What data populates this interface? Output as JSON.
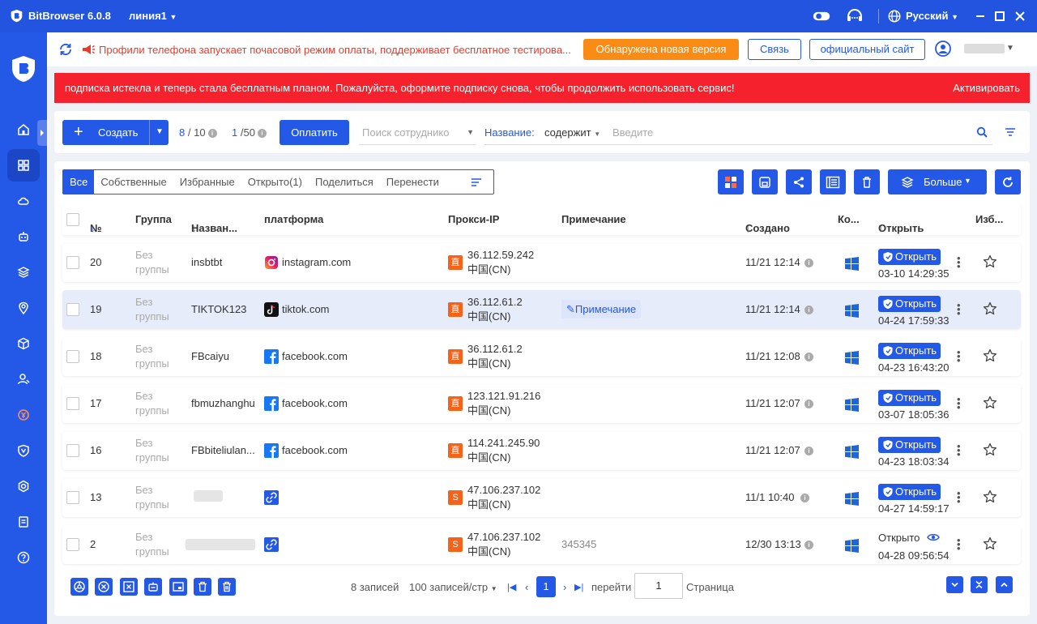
{
  "titlebar": {
    "app_name": "BitBrowser 6.0.8",
    "line": "линия1",
    "language": "Русский"
  },
  "notice": {
    "text": "Профили телефона запускает почасовой режим оплаты, поддерживает бесплатное тестирова...",
    "new_version": "Обнаружена новая версия",
    "contact": "Связь",
    "official_site": "официальный сайт"
  },
  "alert": {
    "text": "подписка истекла и теперь стала бесплатным планом. Пожалуйста, оформите подписку снова, чтобы продолжить использовать сервис!",
    "activate": "Активировать"
  },
  "toolbar": {
    "create": "Создать",
    "count_profiles": "8",
    "count_profiles_total": "/ 10",
    "count_staff": "1",
    "count_staff_total": "/50",
    "pay": "Оплатить",
    "employee_placeholder": "Поиск сотруднико",
    "filter_key": "Название:",
    "filter_op": "содержит",
    "filter_placeholder": "Введите"
  },
  "tabs": [
    "Все",
    "Собственные",
    "Избранные",
    "Открыто(1)",
    "Поделиться",
    "Перенести"
  ],
  "more": "Больше",
  "columns": {
    "no": "№",
    "group": "Группа",
    "name": "Назван...",
    "platform": "платформа",
    "proxy": "Прокси-IP",
    "note": "Примечание",
    "created": "Создано",
    "core": "Ко...",
    "open": "Открыть",
    "fav": "Изб..."
  },
  "rows": [
    {
      "no": "20",
      "group": [
        "Без",
        "группы"
      ],
      "name": "insbtbt",
      "platform": "instagram.com",
      "ptype": "instagram",
      "proxy_type": "直",
      "ip": "36.112.59.242",
      "region": "中国(CN)",
      "note": "",
      "created": "11/21 12:14",
      "open_label": "Открыть",
      "open_time": "03-10 14:29:35",
      "opened": false
    },
    {
      "no": "19",
      "group": [
        "Без",
        "группы"
      ],
      "name": "TIKTOK123",
      "platform": "tiktok.com",
      "ptype": "tiktok",
      "proxy_type": "直",
      "ip": "36.112.61.2",
      "region": "中国(CN)",
      "note": "Примечание",
      "created": "11/21 12:14",
      "open_label": "Открыть",
      "open_time": "04-24 17:59:33",
      "opened": false
    },
    {
      "no": "18",
      "group": [
        "Без",
        "группы"
      ],
      "name": "FBcaiyu",
      "platform": "facebook.com",
      "ptype": "facebook",
      "proxy_type": "直",
      "ip": "36.112.61.2",
      "region": "中国(CN)",
      "note": "",
      "created": "11/21 12:08",
      "open_label": "Открыть",
      "open_time": "04-23 16:43:20",
      "opened": false
    },
    {
      "no": "17",
      "group": [
        "Без",
        "группы"
      ],
      "name": "fbmuzhanghu",
      "platform": "facebook.com",
      "ptype": "facebook",
      "proxy_type": "直",
      "ip": "123.121.91.216",
      "region": "中国(CN)",
      "note": "",
      "created": "11/21 12:07",
      "open_label": "Открыть",
      "open_time": "03-07 18:05:36",
      "opened": false
    },
    {
      "no": "16",
      "group": [
        "Без",
        "группы"
      ],
      "name": "FBbiteliulan...",
      "platform": "facebook.com",
      "ptype": "facebook",
      "proxy_type": "直",
      "ip": "114.241.245.90",
      "region": "中国(CN)",
      "note": "",
      "created": "11/21 12:07",
      "open_label": "Открыть",
      "open_time": "04-23 18:03:34",
      "opened": false
    },
    {
      "no": "13",
      "group": [
        "Без",
        "группы"
      ],
      "name": "",
      "platform": "",
      "ptype": "link",
      "proxy_type": "S",
      "ip": "47.106.237.102",
      "region": "中国(CN)",
      "note": "",
      "created": "11/1 10:40",
      "open_label": "Открыть",
      "open_time": "04-27 14:59:17",
      "opened": false
    },
    {
      "no": "2",
      "group": [
        "Без",
        "группы"
      ],
      "name": "",
      "platform": "",
      "ptype": "link",
      "proxy_type": "S",
      "ip": "47.106.237.102",
      "region": "中国(CN)",
      "note": "345345",
      "created": "12/30 13:13",
      "open_label": "Открыто",
      "open_time": "04-28 09:56:54",
      "opened": true
    }
  ],
  "pagination": {
    "records": "8 записей",
    "per_page": "100 записей/стр",
    "page": "1",
    "goto": "перейти",
    "goto_value": "1",
    "page_label": "Страница"
  },
  "colors": {
    "primary": "#2458e6",
    "orange": "#fa8c16",
    "alert": "#f5222d",
    "proxy_badge": "#f5621a"
  }
}
